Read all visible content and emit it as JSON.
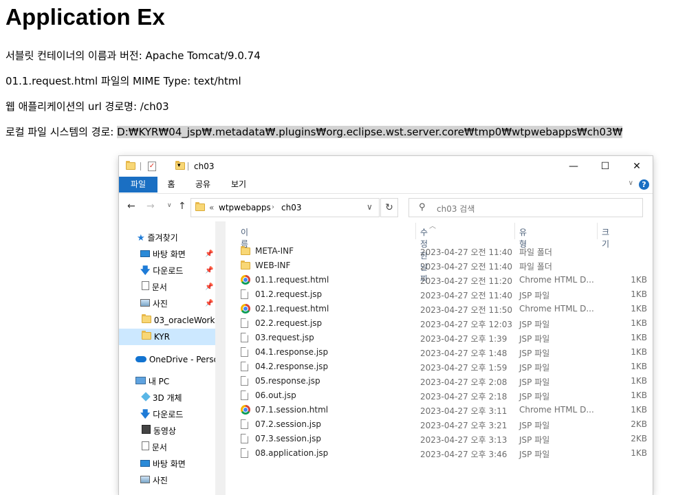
{
  "page": {
    "heading": "Application Ex",
    "lines": [
      "서블릿 컨테이너의 이름과 버전: Apache Tomcat/9.0.74",
      "01.1.request.html 파일의 MIME Type: text/html",
      "웹 애플리케이션의 url 경로명: /ch03"
    ],
    "path_label": "로컬 파일 시스템의 경로: ",
    "path_value": "D:₩KYR₩04_jsp₩.metadata₩.plugins₩org.eclipse.wst.server.core₩tmp0₩wtpwebapps₩ch03₩"
  },
  "explorer": {
    "title": "ch03",
    "window_buttons": {
      "minimize": "—",
      "maximize": "☐",
      "close": "✕"
    },
    "ribbon_tabs": [
      "파일",
      "홈",
      "공유",
      "보기"
    ],
    "help": "?",
    "address": {
      "prefix": "«",
      "parts": [
        "wtpwebapps",
        "ch03"
      ]
    },
    "search_placeholder": "ch03 검색",
    "columns": {
      "name": "이름",
      "date": "수정한 날짜",
      "type": "유형",
      "size": "크기"
    },
    "nav": [
      {
        "label": "즐겨찾기",
        "icon": "star-icon"
      },
      {
        "label": "바탕 화면",
        "icon": "desktop-icon",
        "pinned": true
      },
      {
        "label": "다운로드",
        "icon": "download-icon",
        "pinned": true
      },
      {
        "label": "문서",
        "icon": "document-icon",
        "pinned": true
      },
      {
        "label": "사진",
        "icon": "pictures-icon",
        "pinned": true
      },
      {
        "label": "03_oracleWork",
        "icon": "folder-icon"
      },
      {
        "label": "KYR",
        "icon": "folder-icon",
        "selected": true
      },
      {
        "label": "OneDrive - Perso",
        "icon": "onedrive-icon"
      },
      {
        "label": "내 PC",
        "icon": "pc-icon"
      },
      {
        "label": "3D 개체",
        "icon": "3d-objects-icon"
      },
      {
        "label": "다운로드",
        "icon": "download-icon"
      },
      {
        "label": "동영상",
        "icon": "video-icon"
      },
      {
        "label": "문서",
        "icon": "document-icon"
      },
      {
        "label": "바탕 화면",
        "icon": "desktop-icon"
      },
      {
        "label": "사진",
        "icon": "pictures-icon"
      }
    ],
    "files": [
      {
        "name": "META-INF",
        "date": "2023-04-27 오전 11:40",
        "type": "파일 폴더",
        "size": "",
        "icon": "folder-icon"
      },
      {
        "name": "WEB-INF",
        "date": "2023-04-27 오전 11:40",
        "type": "파일 폴더",
        "size": "",
        "icon": "folder-icon"
      },
      {
        "name": "01.1.request.html",
        "date": "2023-04-27 오전 11:20",
        "type": "Chrome HTML D...",
        "size": "1KB",
        "icon": "chrome-icon"
      },
      {
        "name": "01.2.request.jsp",
        "date": "2023-04-27 오전 11:40",
        "type": "JSP 파일",
        "size": "1KB",
        "icon": "file-icon"
      },
      {
        "name": "02.1.request.html",
        "date": "2023-04-27 오전 11:50",
        "type": "Chrome HTML D...",
        "size": "1KB",
        "icon": "chrome-icon"
      },
      {
        "name": "02.2.request.jsp",
        "date": "2023-04-27 오후 12:03",
        "type": "JSP 파일",
        "size": "1KB",
        "icon": "file-icon"
      },
      {
        "name": "03.request.jsp",
        "date": "2023-04-27 오후 1:39",
        "type": "JSP 파일",
        "size": "1KB",
        "icon": "file-icon"
      },
      {
        "name": "04.1.response.jsp",
        "date": "2023-04-27 오후 1:48",
        "type": "JSP 파일",
        "size": "1KB",
        "icon": "file-icon"
      },
      {
        "name": "04.2.response.jsp",
        "date": "2023-04-27 오후 1:59",
        "type": "JSP 파일",
        "size": "1KB",
        "icon": "file-icon"
      },
      {
        "name": "05.response.jsp",
        "date": "2023-04-27 오후 2:08",
        "type": "JSP 파일",
        "size": "1KB",
        "icon": "file-icon"
      },
      {
        "name": "06.out.jsp",
        "date": "2023-04-27 오후 2:18",
        "type": "JSP 파일",
        "size": "1KB",
        "icon": "file-icon"
      },
      {
        "name": "07.1.session.html",
        "date": "2023-04-27 오후 3:11",
        "type": "Chrome HTML D...",
        "size": "1KB",
        "icon": "chrome-icon"
      },
      {
        "name": "07.2.session.jsp",
        "date": "2023-04-27 오후 3:21",
        "type": "JSP 파일",
        "size": "2KB",
        "icon": "file-icon"
      },
      {
        "name": "07.3.session.jsp",
        "date": "2023-04-27 오후 3:13",
        "type": "JSP 파일",
        "size": "2KB",
        "icon": "file-icon"
      },
      {
        "name": "08.application.jsp",
        "date": "2023-04-27 오후 3:46",
        "type": "JSP 파일",
        "size": "1KB",
        "icon": "file-icon"
      }
    ]
  }
}
